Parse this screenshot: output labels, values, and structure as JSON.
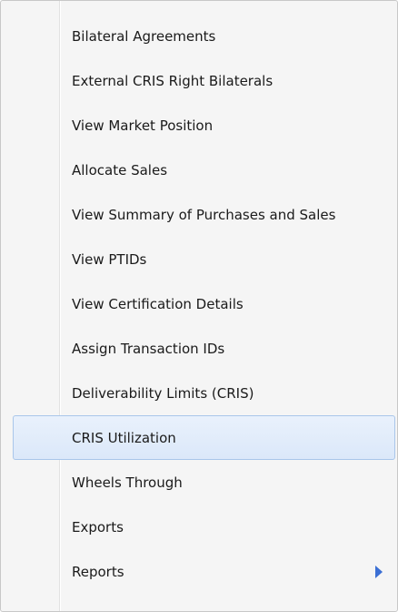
{
  "menu": {
    "items": [
      {
        "label": "Bilateral Agreements"
      },
      {
        "label": "External CRIS Right Bilaterals"
      },
      {
        "label": "View Market Position"
      },
      {
        "label": "Allocate Sales"
      },
      {
        "label": "View Summary of Purchases and Sales"
      },
      {
        "label": "View PTIDs"
      },
      {
        "label": "View Certification Details"
      },
      {
        "label": "Assign Transaction IDs"
      },
      {
        "label": "Deliverability Limits (CRIS)"
      },
      {
        "label": "CRIS Utilization",
        "highlighted": true
      },
      {
        "label": "Wheels Through"
      },
      {
        "label": "Exports"
      },
      {
        "label": "Reports",
        "submenu_icon": "chevron-right-icon"
      }
    ]
  },
  "colors": {
    "menu_background": "#f5f5f5",
    "highlight_background": "#dbe8f9",
    "highlight_border": "#a9c6ea",
    "submenu_arrow": "#3b6fd4"
  }
}
